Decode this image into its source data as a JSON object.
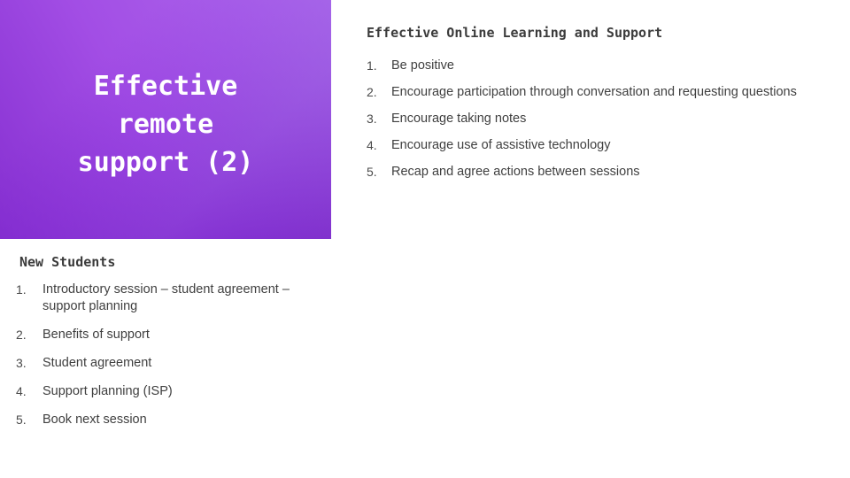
{
  "slide": {
    "background_color": "#ffffff",
    "title_panel": {
      "text": "Effective\nremote\nsupport  (2)",
      "gradient_from": "#a450e6",
      "gradient_to": "#6e16c0",
      "text_color": "#ffffff"
    },
    "right_section": {
      "heading": "Effective Online Learning and Support",
      "items": [
        {
          "number": "1.",
          "text": "Be positive"
        },
        {
          "number": "2.",
          "text": "Encourage participation through conversation and requesting questions"
        },
        {
          "number": "3.",
          "text": "Encourage taking notes"
        },
        {
          "number": "4.",
          "text": "Encourage use of assistive technology"
        },
        {
          "number": "5.",
          "text": "Recap and agree actions between sessions"
        }
      ]
    },
    "bottom_section": {
      "heading": "New Students",
      "items": [
        {
          "number": "1.",
          "text": "Introductory session – student agreement – support planning"
        },
        {
          "number": "2.",
          "text": "Benefits of support"
        },
        {
          "number": "3.",
          "text": "Student agreement"
        },
        {
          "number": "4.",
          "text": "Support planning (ISP)"
        },
        {
          "number": "5.",
          "text": "Book next session"
        }
      ]
    },
    "text_color": "#3f3f3f"
  }
}
